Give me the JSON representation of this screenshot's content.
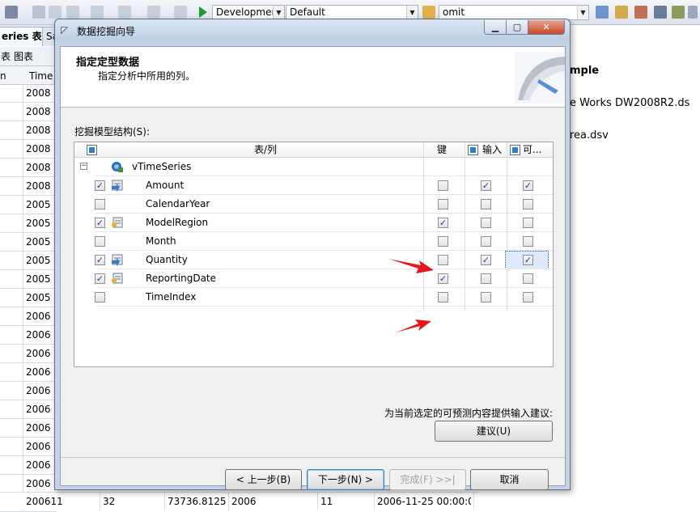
{
  "toolbar": {
    "config_combo": "Developmer",
    "platform_combo": "Default",
    "find_combo": "omit"
  },
  "doc_tabs": {
    "tab1": "eries 表",
    "tab2": "Sa"
  },
  "sub_tabs": {
    "tab1": "表",
    "tab2": "图表"
  },
  "bg_grid": {
    "col1": "n",
    "col2": "Time",
    "rows": [
      "2008",
      "2008",
      "2008",
      "2008",
      "2008",
      "2008",
      "2005",
      "2005",
      "2005",
      "2005",
      "2005",
      "2005",
      "2006",
      "2006",
      "2006",
      "2006",
      "2006",
      "2006",
      "2006",
      "2006",
      "2006",
      "2006",
      "2006"
    ],
    "last_row": [
      "200611",
      "32",
      "73736.8125",
      "2006",
      "11",
      "2006-11-25 00:00:0"
    ]
  },
  "right_pane": {
    "heading": "mple",
    "item1": "e Works DW2008R2.ds",
    "item2": "rea.dsv"
  },
  "dialog": {
    "title": "数据挖掘向导",
    "banner_title": "指定定型数据",
    "banner_subtitle": "指定分析中所用的列。",
    "section_label": "挖掘模型结构(S):",
    "columns": {
      "table_col": "表/列",
      "key": "键",
      "input": "输入",
      "predict": "可..."
    },
    "table_name": "vTimeSeries",
    "rows": [
      {
        "name": "Amount",
        "include": true,
        "key": false,
        "input": true,
        "predict": true,
        "icon": "numeric-column-icon"
      },
      {
        "name": "CalendarYear",
        "include": false,
        "key": false,
        "input": false,
        "predict": false,
        "icon": ""
      },
      {
        "name": "ModelRegion",
        "include": true,
        "key": true,
        "input": false,
        "predict": false,
        "icon": "key-column-icon"
      },
      {
        "name": "Month",
        "include": false,
        "key": false,
        "input": false,
        "predict": false,
        "icon": ""
      },
      {
        "name": "Quantity",
        "include": true,
        "key": false,
        "input": true,
        "predict": true,
        "icon": "numeric-column-icon"
      },
      {
        "name": "ReportingDate",
        "include": true,
        "key": true,
        "input": false,
        "predict": false,
        "icon": "key-column-icon"
      },
      {
        "name": "TimeIndex",
        "include": false,
        "key": false,
        "input": false,
        "predict": false,
        "icon": ""
      }
    ],
    "suggest_text": "为当前选定的可预测内容提供输入建议:",
    "suggest_button": "建议(U)",
    "back_button": "< 上一步(B)",
    "next_button": "下一步(N) >",
    "finish_button": "完成(F) >>|",
    "cancel_button": "取消"
  },
  "colors": {
    "arrow": "#e8141c",
    "check": "#1c3f94",
    "selected_cell": "#dceafc"
  }
}
